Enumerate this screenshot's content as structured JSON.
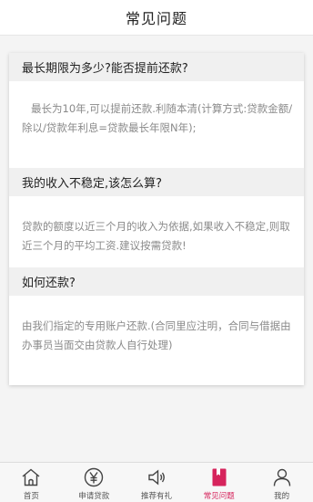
{
  "header": {
    "title": "常见问题"
  },
  "faq": [
    {
      "question": "最长期限为多少?能否提前还款?",
      "answer": "最长为10年,可以提前还款.利随本清(计算方式:贷款金额/除以/贷款年利息=贷款最长年限N年);"
    },
    {
      "question": "我的收入不稳定,该怎么算?",
      "answer": "贷款的额度以近三个月的收入为依据,如果收入不稳定,则取近三个月的平均工资.建议按需贷款!"
    },
    {
      "question": "如何还款?",
      "answer": "由我们指定的专用账户还款.(合同里应注明，合同与借据由办事员当面交由贷款人自行处理)"
    }
  ],
  "tabbar": {
    "active_color": "#d6245c",
    "items": [
      {
        "label": "首页",
        "icon": "home-icon"
      },
      {
        "label": "申请贷款",
        "icon": "yen-coin-icon"
      },
      {
        "label": "推荐有礼",
        "icon": "speaker-icon"
      },
      {
        "label": "常见问题",
        "icon": "bookmark-book-icon",
        "active": true
      },
      {
        "label": "我的",
        "icon": "user-icon"
      }
    ]
  }
}
